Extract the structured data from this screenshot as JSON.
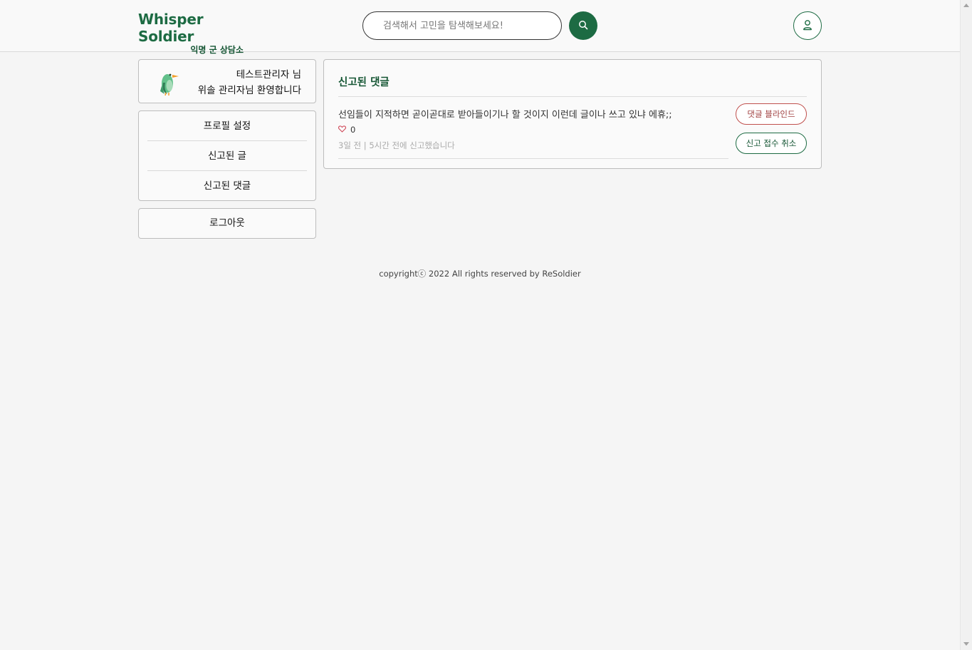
{
  "header": {
    "logo_title": "Whisper Soldier",
    "logo_subtitle": "익명 군 상담소",
    "search_placeholder": "검색해서 고민을 탐색해보세요!",
    "search_icon": "search-icon",
    "profile_icon": "user-icon",
    "accent_color": "#1d6b43"
  },
  "sidebar": {
    "welcome": {
      "avatar_icon": "bird-icon",
      "line1": "테스트관리자 님",
      "line2": "위솔 관리자님 환영합니다"
    },
    "menu": [
      {
        "label": "프로필 설정"
      },
      {
        "label": "신고된 글"
      },
      {
        "label": "신고된 댓글"
      }
    ],
    "logout_label": "로그아웃"
  },
  "main": {
    "title": "신고된 댓글",
    "comments": [
      {
        "text": "선임들이 지적하면 곧이곧대로 받아들이기나 할 것이지 이런데 글이나 쓰고 있냐 에휴;;",
        "like_icon": "heart-icon",
        "likes": "0",
        "meta": "3일 전 | 5시간 전에 신고했습니다",
        "blind_label": "댓글 블라인드",
        "cancel_label": "신고 접수 취소"
      }
    ]
  },
  "footer": {
    "text": "copyrightⓒ 2022 All rights reserved by ReSoldier"
  }
}
